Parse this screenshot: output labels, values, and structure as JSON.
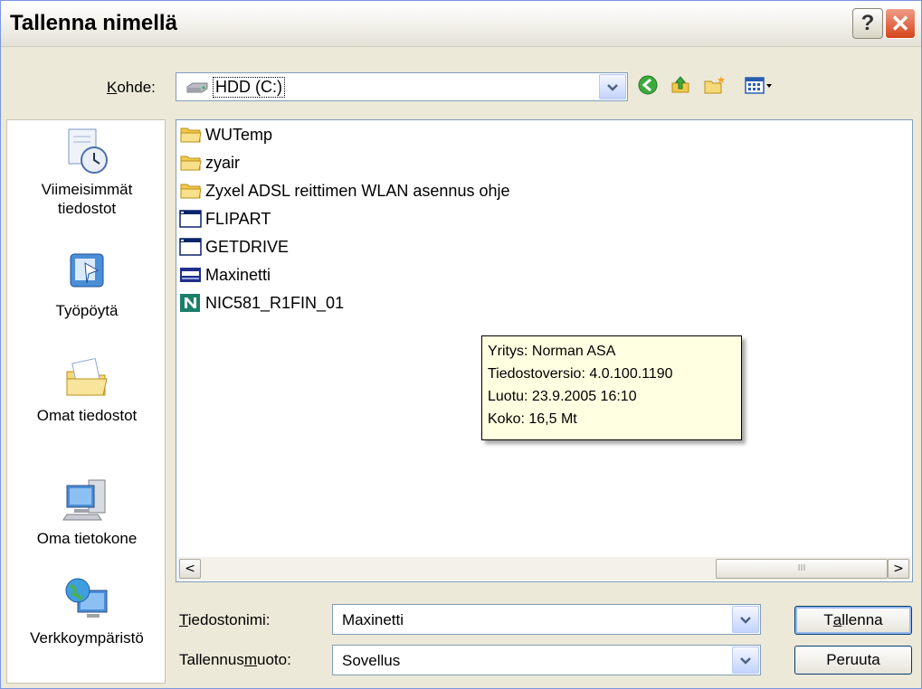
{
  "window": {
    "title": "Tallenna nimellä"
  },
  "location": {
    "label_prefix": "K",
    "label_rest": "ohde:",
    "value": "HDD (C:)"
  },
  "places": [
    {
      "line1": "Viimeisimmät",
      "line2": "tiedostot"
    },
    {
      "line1": "Työpöytä",
      "line2": ""
    },
    {
      "line1": "Omat tiedostot",
      "line2": ""
    },
    {
      "line1": "Oma tietokone",
      "line2": ""
    },
    {
      "line1": "Verkkoympäristö",
      "line2": ""
    }
  ],
  "files": [
    {
      "name": "WUTemp",
      "icon": "folder-icon"
    },
    {
      "name": "zyair",
      "icon": "folder-icon"
    },
    {
      "name": "Zyxel ADSL reittimen WLAN asennus ohje",
      "icon": "folder-icon"
    },
    {
      "name": "FLIPART",
      "icon": "application-icon"
    },
    {
      "name": "GETDRIVE",
      "icon": "application-icon"
    },
    {
      "name": "Maxinetti",
      "icon": "zyxel-app-icon"
    },
    {
      "name": "NIC581_R1FIN_01",
      "icon": "norman-app-icon"
    }
  ],
  "tooltip": {
    "company": "Yritys: Norman ASA",
    "version": "Tiedostoversio: 4.0.100.1190",
    "created": "Luotu: 23.9.2005 16:10",
    "size": "Koko: 16,5 Mt"
  },
  "filename": {
    "label_prefix": "T",
    "label_rest": "iedostonimi:",
    "value": "Maxinetti"
  },
  "filetype": {
    "label_start": "Tallennus",
    "label_underlined": "m",
    "label_end": "uoto:",
    "value": "Sovellus"
  },
  "buttons": {
    "save_prefix": "T",
    "save_underlined": "a",
    "save_rest": "llenna",
    "cancel": "Peruuta"
  },
  "scrollbar": {
    "thumb_grip": "III"
  },
  "colors": {
    "accent": "#316ac5",
    "tooltip_bg": "#ffffe1",
    "close": "#d4441b"
  }
}
